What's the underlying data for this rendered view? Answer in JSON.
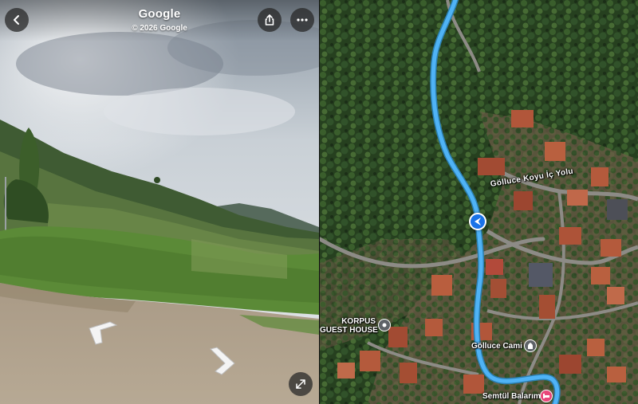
{
  "street_view": {
    "title": "Google",
    "copyright": "© 2026 Google",
    "buttons": {
      "back": "back",
      "share": "share",
      "more": "more",
      "expand": "expand"
    }
  },
  "map": {
    "road_label": "Gölluce Koyu İç Yolu",
    "pois": [
      {
        "name": "KORPUS\nGUEST HOUSE",
        "line1": "KORPUS",
        "line2": "GUEST HOUSE",
        "icon": "pin-icon",
        "color": "#5f6368"
      },
      {
        "name": "Gölluce Cami",
        "icon": "mosque-icon",
        "color": "#5f6368"
      },
      {
        "name": "Semtül Balarım",
        "icon": "lodging-icon",
        "color": "#e8477a"
      }
    ],
    "route_color": "#4fb3f6",
    "location_color": "#1a73e8"
  }
}
